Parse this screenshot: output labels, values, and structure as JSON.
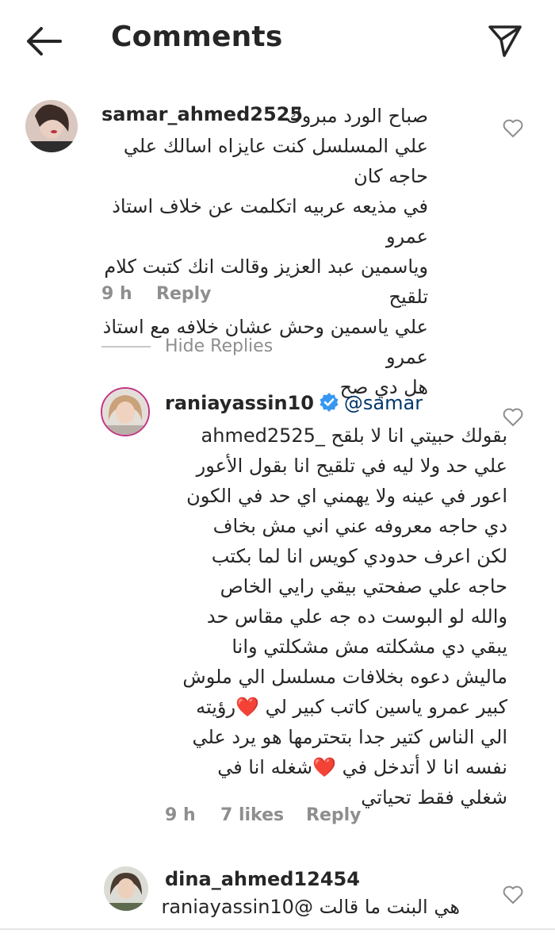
{
  "header": {
    "title": "Comments",
    "back_icon": "arrow-left-icon",
    "send_icon": "send-icon"
  },
  "comments": [
    {
      "username": "samar_ahmed2525",
      "text": "صباح الورد مبروك\nعلي المسلسل كنت عايزاه اسالك علي حاجه كان\nفي مذيعه عربيه اتكلمت عن خلاف استاذ عمرو\nوياسمين عبد العزيز وقالت انك كتبت كلام تلقيح\nعلي ياسمين وحش عشان خلافه مع استاذ عمرو\nهل دي صح",
      "time": "9 h",
      "reply_label": "Reply"
    },
    {
      "username": "raniayassin10",
      "mention": "@samar",
      "text": "بقولك حبيتي انا لا بلقح _ahmed2525\nعلي حد ولا ليه في تلقيح انا بقول الأعور\nاعور في عينه ولا يهمني اي حد في الكون\nدي حاجه معروفه عني اني  مش بخاف\nلكن اعرف حدودي كويس انا لما بكتب\nحاجه علي صفحتي بيقي رايي الخاص\nوالله لو البوست ده جه علي مقاس حد\nيبقي دي مشكلته مش مشكلتي  وانا\nماليش دعوه بخلافات مسلسل الي ملوش\nكبير عمرو ياسين كاتب كبير لي ❤️رؤيته\nالي الناس كتير جدا بتحترمها هو يرد علي\nنفسه انا لا أتدخل في ❤️شغله انا في\nشغلي فقط تحياتي",
      "time": "9 h",
      "likes": "7 likes",
      "reply_label": "Reply"
    },
    {
      "username": "dina_ahmed12454",
      "text": "هي البنت ما قالت @raniayassin10",
      "time": "",
      "reply_label": ""
    }
  ],
  "hide_replies": "Hide Replies",
  "colors": {
    "muted": "#8e8e8e",
    "text": "#262626",
    "heart": "#ed4956",
    "verified": "#3897f0",
    "mention": "#00376b"
  }
}
